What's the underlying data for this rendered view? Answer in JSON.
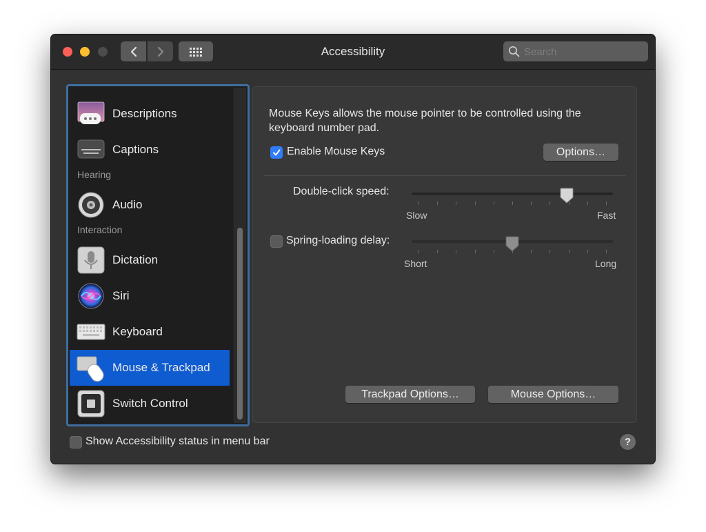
{
  "window": {
    "title": "Accessibility",
    "search_placeholder": "Search"
  },
  "sidebar": {
    "items": [
      {
        "label": "Descriptions",
        "icon": "descriptions-icon"
      },
      {
        "label": "Captions",
        "icon": "captions-icon"
      },
      {
        "label": "Audio",
        "icon": "speaker-icon",
        "section": "Hearing"
      },
      {
        "label": "Dictation",
        "icon": "microphone-icon",
        "section": "Interaction"
      },
      {
        "label": "Siri",
        "icon": "siri-icon"
      },
      {
        "label": "Keyboard",
        "icon": "keyboard-icon"
      },
      {
        "label": "Mouse & Trackpad",
        "icon": "mouse-trackpad-icon",
        "selected": true
      },
      {
        "label": "Switch Control",
        "icon": "switch-control-icon"
      }
    ],
    "sections": [
      "Hearing",
      "Interaction"
    ]
  },
  "panel": {
    "description": "Mouse Keys allows the mouse pointer to be controlled using the keyboard number pad.",
    "enable_mouse_keys": {
      "label": "Enable Mouse Keys",
      "checked": true
    },
    "options_button": "Options…",
    "double_click": {
      "label": "Double-click speed:",
      "min_label": "Slow",
      "max_label": "Fast",
      "value": 0.79
    },
    "spring_loading": {
      "label": "Spring-loading delay:",
      "checked": false,
      "min_label": "Short",
      "max_label": "Long",
      "value": 0.5
    },
    "trackpad_options_button": "Trackpad Options…",
    "mouse_options_button": "Mouse Options…"
  },
  "footer": {
    "status_label": "Show Accessibility status in menu bar",
    "status_checked": false,
    "help": "?"
  },
  "colors": {
    "accent": "#0f5bd0",
    "checkbox": "#2f7cf6",
    "window_bg": "#323232",
    "sidebar_bg": "#1e1e1e"
  }
}
